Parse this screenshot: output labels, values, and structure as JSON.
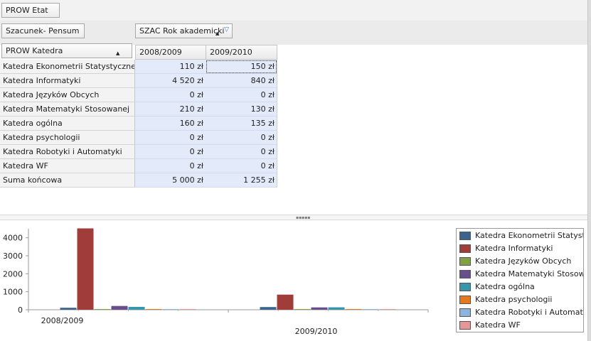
{
  "filter_area": {
    "field": "PROW Etat"
  },
  "data_area": {
    "field": "Szacunek- Pensum"
  },
  "column_area": {
    "field": "SZAC Rok akademicki",
    "sort_icon": "sort-up-icon",
    "filter_icon": "filter-icon"
  },
  "row_area": {
    "field": "PROW Katedra",
    "sort_icon": "sort-up-icon"
  },
  "columns": [
    "2008/2009",
    "2009/2010"
  ],
  "rows": [
    {
      "label": "Katedra Ekonometrii Statystycznej",
      "values": [
        "110 zł",
        "150 zł"
      ]
    },
    {
      "label": "Katedra Informatyki",
      "values": [
        "4 520 zł",
        "840 zł"
      ]
    },
    {
      "label": "Katedra Języków Obcych",
      "values": [
        "0 zł",
        "0 zł"
      ]
    },
    {
      "label": "Katedra Matematyki Stosowanej",
      "values": [
        "210 zł",
        "130 zł"
      ]
    },
    {
      "label": "Katedra ogólna",
      "values": [
        "160 zł",
        "135 zł"
      ]
    },
    {
      "label": "Katedra psychologii",
      "values": [
        "0 zł",
        "0 zł"
      ]
    },
    {
      "label": "Katedra Robotyki i Automatyki",
      "values": [
        "0 zł",
        "0 zł"
      ]
    },
    {
      "label": "Katedra WF",
      "values": [
        "0 zł",
        "0 zł"
      ]
    }
  ],
  "total_row": {
    "label": "Suma końcowa",
    "values": [
      "5 000 zł",
      "1 255 zł"
    ]
  },
  "chart_data": {
    "type": "bar",
    "categories": [
      "2008/2009",
      "2009/2010"
    ],
    "ylim": [
      0,
      4500
    ],
    "yticks": [
      0,
      1000,
      2000,
      3000,
      4000
    ],
    "grid": false,
    "legend": "right",
    "series": [
      {
        "name": "Katedra Ekonometrii Statystycznej",
        "color": "#3c648c",
        "values": [
          110,
          150
        ]
      },
      {
        "name": "Katedra Informatyki",
        "color": "#a03c3a",
        "values": [
          4520,
          840
        ]
      },
      {
        "name": "Katedra Języków Obcych",
        "color": "#82a046",
        "values": [
          0,
          0
        ]
      },
      {
        "name": "Katedra Matematyki Stosowanej",
        "color": "#6a4e8c",
        "values": [
          210,
          130
        ]
      },
      {
        "name": "Katedra ogólna",
        "color": "#3796aa",
        "values": [
          160,
          135
        ]
      },
      {
        "name": "Katedra psychologii",
        "color": "#e6781e",
        "values": [
          0,
          0
        ]
      },
      {
        "name": "Katedra Robotyki i Automatyki",
        "color": "#8cb4dc",
        "values": [
          0,
          0
        ]
      },
      {
        "name": "Katedra WF",
        "color": "#e69696",
        "values": [
          0,
          0
        ]
      }
    ]
  }
}
